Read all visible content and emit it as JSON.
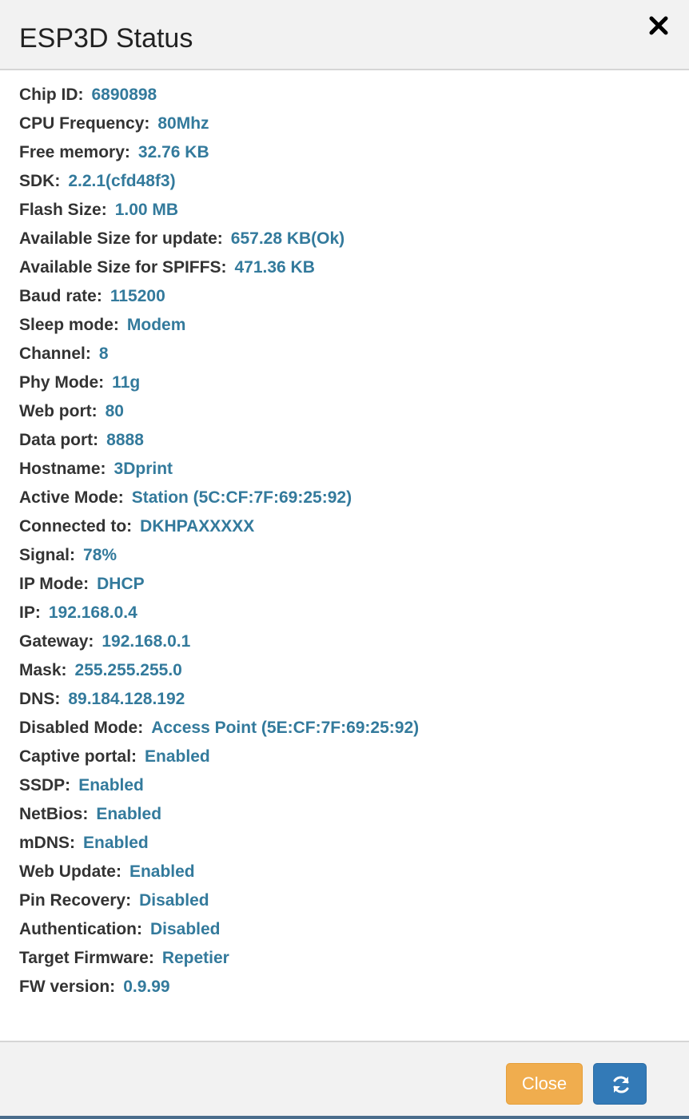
{
  "dialog": {
    "title": "ESP3D Status",
    "close_icon": "close-x-icon"
  },
  "status_rows": [
    {
      "label": "Chip ID:",
      "value": "6890898"
    },
    {
      "label": "CPU Frequency:",
      "value": "80Mhz"
    },
    {
      "label": "Free memory:",
      "value": "32.76 KB"
    },
    {
      "label": "SDK:",
      "value": "2.2.1(cfd48f3)"
    },
    {
      "label": "Flash Size:",
      "value": "1.00 MB"
    },
    {
      "label": "Available Size for update:",
      "value": "657.28 KB(Ok)"
    },
    {
      "label": "Available Size for SPIFFS:",
      "value": "471.36 KB"
    },
    {
      "label": "Baud rate:",
      "value": "115200"
    },
    {
      "label": "Sleep mode:",
      "value": "Modem"
    },
    {
      "label": "Channel:",
      "value": "8"
    },
    {
      "label": "Phy Mode:",
      "value": "11g"
    },
    {
      "label": "Web port:",
      "value": "80"
    },
    {
      "label": "Data port:",
      "value": "8888"
    },
    {
      "label": "Hostname:",
      "value": "3Dprint"
    },
    {
      "label": "Active Mode:",
      "value": "Station (5C:CF:7F:69:25:92)"
    },
    {
      "label": "Connected to:",
      "value": "DKHPAXXXXX"
    },
    {
      "label": "Signal:",
      "value": "78%"
    },
    {
      "label": "IP Mode:",
      "value": "DHCP"
    },
    {
      "label": "IP:",
      "value": "192.168.0.4"
    },
    {
      "label": "Gateway:",
      "value": "192.168.0.1"
    },
    {
      "label": "Mask:",
      "value": "255.255.255.0"
    },
    {
      "label": "DNS:",
      "value": "89.184.128.192"
    },
    {
      "label": "Disabled Mode:",
      "value": "Access Point (5E:CF:7F:69:25:92)"
    },
    {
      "label": "Captive portal:",
      "value": "Enabled"
    },
    {
      "label": "SSDP:",
      "value": "Enabled"
    },
    {
      "label": "NetBios:",
      "value": "Enabled"
    },
    {
      "label": "mDNS:",
      "value": "Enabled"
    },
    {
      "label": "Web Update:",
      "value": "Enabled"
    },
    {
      "label": "Pin Recovery:",
      "value": "Disabled"
    },
    {
      "label": "Authentication:",
      "value": "Disabled"
    },
    {
      "label": "Target Firmware:",
      "value": "Repetier"
    },
    {
      "label": "FW version:",
      "value": "0.9.99"
    }
  ],
  "footer": {
    "close_label": "Close",
    "refresh_icon": "refresh-icon"
  },
  "colors": {
    "value_text": "#337a9c",
    "close_button": "#f0ad4e",
    "refresh_button": "#337ab7"
  }
}
